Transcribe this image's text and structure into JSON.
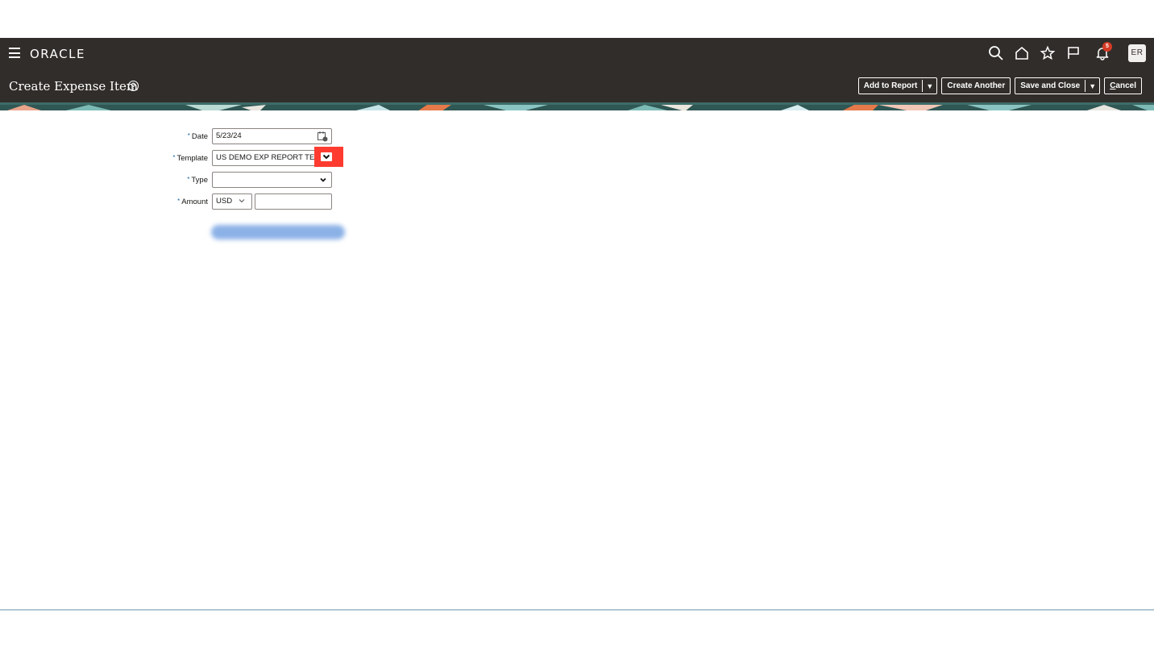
{
  "app": {
    "logo": "ORACLE",
    "notification_count": "5",
    "user_initials": "ER"
  },
  "header": {
    "title": "Create Expense Item"
  },
  "actions": {
    "add_to_report": "Add to Report",
    "create_another": "Create Another",
    "save_and_close": "Save and Close",
    "cancel_prefix": "C",
    "cancel_rest": "ancel"
  },
  "form": {
    "date": {
      "label": "Date",
      "value": "5/23/24"
    },
    "template": {
      "label": "Template",
      "value": "US DEMO EXP REPORT TEM"
    },
    "type": {
      "label": "Type",
      "value": ""
    },
    "amount": {
      "label": "Amount",
      "currency": "USD",
      "value": ""
    }
  },
  "colors": {
    "navbar": "#312d2a",
    "required": "#1a6aa5",
    "highlight": "#ff3b30"
  }
}
